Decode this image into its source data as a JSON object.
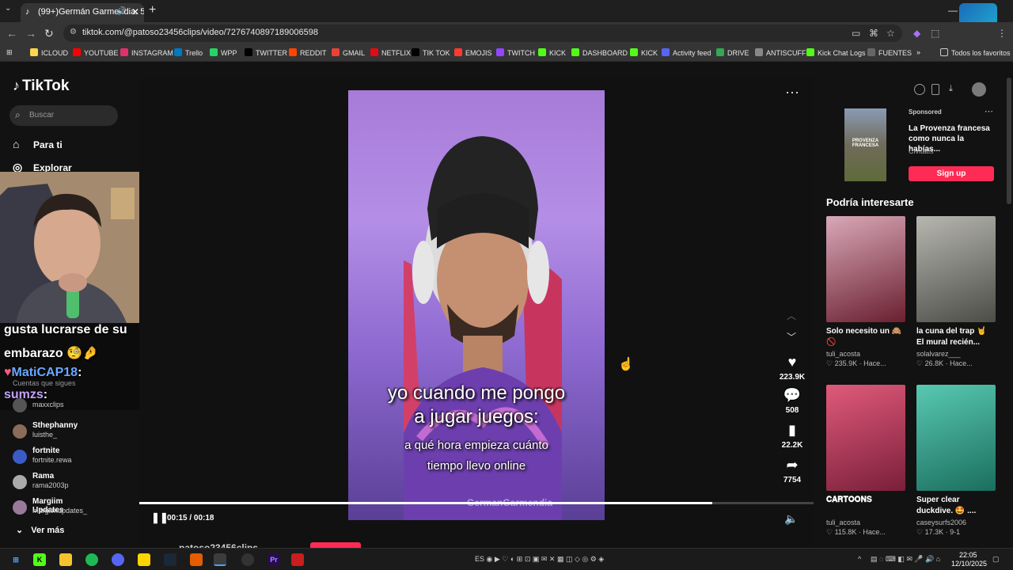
{
  "browser": {
    "tab_title": "(99+)Germán Garmendia: 5",
    "url": "tiktok.com/@patoso23456clips/video/7276740897189006598",
    "bookmarks": [
      "ICLOUD",
      "YOUTUBE",
      "INSTAGRAM",
      "Trello",
      "WPP",
      "TWITTER",
      "REDDIT",
      "GMAIL",
      "NETFLIX",
      "TIK TOK",
      "EMOJIS",
      "TWITCH",
      "KICK",
      "DASHBOARD",
      "KICK",
      "Activity feed",
      "DRIVE",
      "ANTISCUFF",
      "Kick Chat Logs",
      "FUENTES"
    ],
    "bookmarks_more": "»",
    "all_bookmarks": "Todos los favoritos",
    "bookmark_colors": [
      "#ffd54f",
      "#ff0000",
      "#e1306c",
      "#0079bf",
      "#25d366",
      "#000000",
      "#ff4500",
      "#ea4335",
      "#e50914",
      "#000000",
      "#ff3b30",
      "#9146ff",
      "#53fc18",
      "#53fc18",
      "#53fc18",
      "#5865f2",
      "#34a853",
      "#888888",
      "#53fc18",
      "#666666"
    ]
  },
  "sidebar": {
    "logo": "TikTok",
    "search_placeholder": "Buscar",
    "nav": [
      {
        "label": "Para ti",
        "icon": "home-icon"
      },
      {
        "label": "Explorar",
        "icon": "compass-icon"
      }
    ],
    "following_title": "Cuentas que sigues",
    "following": [
      {
        "name": "",
        "handle": "maxxclips"
      },
      {
        "name": "Sthephanny",
        "handle": "luisthe_"
      },
      {
        "name": "fortnite",
        "handle": "fortnite.rewa"
      },
      {
        "name": "Rama",
        "handle": "rama2003p"
      },
      {
        "name": "Margiim Updates",
        "handle": "margiimupdates_"
      }
    ],
    "see_more": "Ver más"
  },
  "overlay_chat": {
    "line1": "gusta lucrarse de su",
    "line2": "embarazo 🧐🤌",
    "line3_user": "MatiCAP18",
    "line3_suffix": ":",
    "line4_user": "sumzs",
    "line4_suffix": ":"
  },
  "video": {
    "caption_main_1": "yo cuando me pongo",
    "caption_main_2": "a jugar juegos:",
    "caption_sub_1": "a qué hora empieza cuánto",
    "caption_sub_2": "tiempo llevo online",
    "watermark": "GermanGarmendia",
    "current_time": "00:15",
    "duration": "00:18",
    "time_separator": " / ",
    "progress": 0.85,
    "likes": "223.9K",
    "comments": "508",
    "saves": "22.2K",
    "shares": "7754",
    "author": "patoso23456clips"
  },
  "ad": {
    "sponsored": "Sponsored",
    "thumb_text": "PROVENZA FRANCESA",
    "title": "La Provenza francesa como nunca la habías...",
    "brand": "Civitatis",
    "cta": "Sign up"
  },
  "recommendations": {
    "title": "Podría interesarte",
    "items": [
      {
        "title": "Solo necesito un 🙈🚫",
        "user": "tuli_acosta",
        "stats": "♡ 235.9K · Hace...",
        "color1": "#d9a8b8",
        "color2": "#6a2030"
      },
      {
        "title": "la cuna del trap 🤘 El mural recién...",
        "user": "solalvarez___",
        "stats": "♡ 26.8K · Hace...",
        "color1": "#b7b7b0",
        "color2": "#4d4d48"
      },
      {
        "title": "𝐂𝐀𝐑𝐓𝐎𝐎𝐍𝐒",
        "user": "tuli_acosta",
        "stats": "♡ 115.8K · Hace...",
        "color1": "#e05a7a",
        "color2": "#7a1f3a"
      },
      {
        "title": "Super clear duckdive. 🤩 ....",
        "user": "caseysurfs2006",
        "stats": "♡ 17.3K · 9-1",
        "color1": "#58c9b2",
        "color2": "#1b6e5e"
      }
    ]
  },
  "taskbar": {
    "time": "22:05",
    "date": "12/10/2025"
  }
}
